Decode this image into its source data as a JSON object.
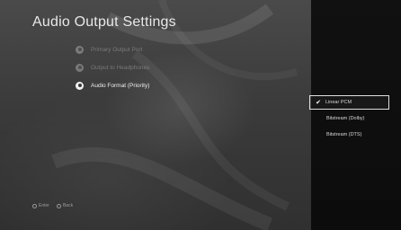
{
  "header": {
    "title": "Audio Output Settings"
  },
  "menu": {
    "items": [
      {
        "label": "Primary Output Port",
        "active": false,
        "icon": "circle-bullet-icon"
      },
      {
        "label": "Output to Headphones",
        "active": false,
        "icon": "circle-bullet-icon"
      },
      {
        "label": "Audio Format (Priority)",
        "active": true,
        "icon": "circle-bullet-icon"
      }
    ]
  },
  "options_panel": {
    "options": [
      {
        "label": "Linear PCM",
        "checked": true
      },
      {
        "label": "Bitstream (Dolby)",
        "checked": false
      },
      {
        "label": "Bitstream (DTS)",
        "checked": false
      }
    ],
    "check_glyph": "✔"
  },
  "hints": {
    "enter": "Enter",
    "back": "Back"
  }
}
